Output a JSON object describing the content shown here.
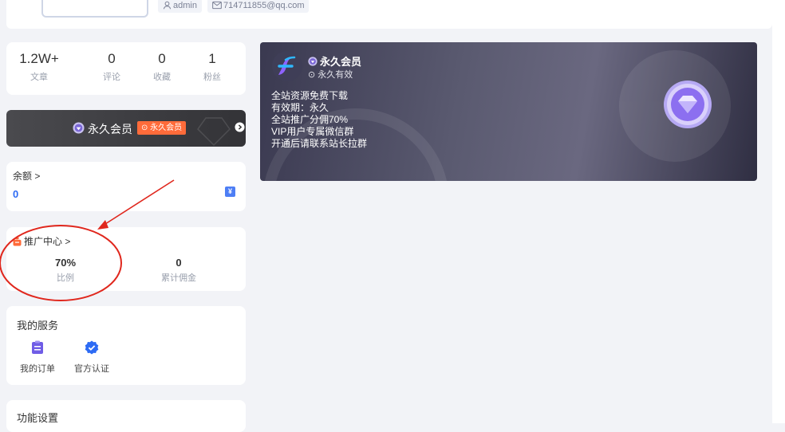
{
  "profile": {
    "username": "admin",
    "email": "714711855@qq.com"
  },
  "stats": [
    {
      "value": "1.2W+",
      "label": "文章"
    },
    {
      "value": "0",
      "label": "评论"
    },
    {
      "value": "0",
      "label": "收藏"
    },
    {
      "value": "1",
      "label": "粉丝"
    }
  ],
  "member_bar": {
    "title": "永久会员",
    "badge": "⊙ 永久会员"
  },
  "balance": {
    "label": "余额 >",
    "value": "0",
    "icon": "yen-icon"
  },
  "promo": {
    "title": "推广中心 >",
    "ratio_value": "70%",
    "ratio_label": "比例",
    "commission_value": "0",
    "commission_label": "累计佣金"
  },
  "services": {
    "title": "我的服务",
    "items": [
      {
        "label": "我的订单",
        "icon": "order-icon"
      },
      {
        "label": "官方认证",
        "icon": "verified-icon"
      }
    ]
  },
  "settings": {
    "title": "功能设置"
  },
  "vip_card": {
    "title": "永久会员",
    "subtitle": "⊙ 永久有效",
    "perks": [
      "全站资源免费下载",
      "有效期：永久",
      "全站推广分佣70%",
      "VIP用户专属微信群",
      "开通后请联系站长拉群"
    ]
  },
  "colors": {
    "accent_blue": "#2d6bf4",
    "badge_orange": "#ff6b3a",
    "annotation_red": "#e0271d"
  }
}
